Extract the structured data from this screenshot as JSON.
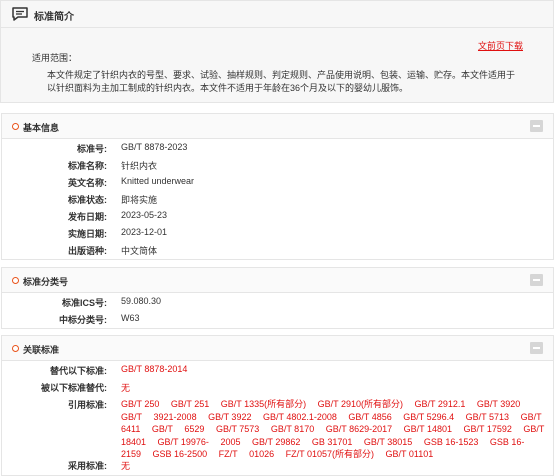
{
  "intro": {
    "title": "标准简介",
    "preview_link": "文前页下载",
    "scope_label": "适用范围：",
    "scope_text": "本文件规定了针织内衣的号型、要求、试验、抽样规则、判定规则、产品使用说明、包装、运输、贮存。本文件适用于以针织面料为主加工制成的针织内衣。本文件不适用于年龄在36个月及以下的婴幼儿服饰。"
  },
  "basic": {
    "title": "基本信息",
    "rows": [
      {
        "label": "标准号:",
        "value": "GB/T 8878-2023"
      },
      {
        "label": "标准名称:",
        "value": "针织内衣"
      },
      {
        "label": "英文名称:",
        "value": "Knitted underwear"
      },
      {
        "label": "标准状态:",
        "value": "即将实施"
      },
      {
        "label": "发布日期:",
        "value": "2023-05-23"
      },
      {
        "label": "实施日期:",
        "value": "2023-12-01"
      },
      {
        "label": "出版语种:",
        "value": "中文简体"
      }
    ]
  },
  "classification": {
    "title": "标准分类号",
    "rows": [
      {
        "label": "标准ICS号:",
        "value": "59.080.30"
      },
      {
        "label": "中标分类号:",
        "value": "W63"
      }
    ]
  },
  "related": {
    "title": "关联标准",
    "replaces_label": "替代以下标准:",
    "replaces_value": "GB/T 8878-2014",
    "replaced_by_label": "被以下标准替代:",
    "replaced_by_value": "无",
    "cites_label": "引用标准:",
    "cites": [
      "GB/T 250",
      "GB/T 251",
      "GB/T 1335(所有部分)",
      "GB/T 2910(所有部分)",
      "GB/T 2912.1",
      "GB/T 3920",
      "GB/T",
      "3921-2008",
      "GB/T 3922",
      "GB/T 4802.1-2008",
      "GB/T 4856",
      "GB/T 5296.4",
      "GB/T 5713",
      "GB/T 6411",
      "GB/T",
      "6529",
      "GB/T 7573",
      "GB/T 8170",
      "GB/T 8629-2017",
      "GB/T 14801",
      "GB/T 17592",
      "GB/T 18401",
      "GB/T 19976-",
      "2005",
      "GB/T 29862",
      "GB 31701",
      "GB/T 38015",
      "GSB 16-1523",
      "GSB 16-2159",
      "GSB 16-2500",
      "FZ/T",
      "01026",
      "FZ/T 01057(所有部分)",
      "GB/T 01101"
    ],
    "adopts_label": "采用标准:",
    "adopts_value": "无"
  }
}
